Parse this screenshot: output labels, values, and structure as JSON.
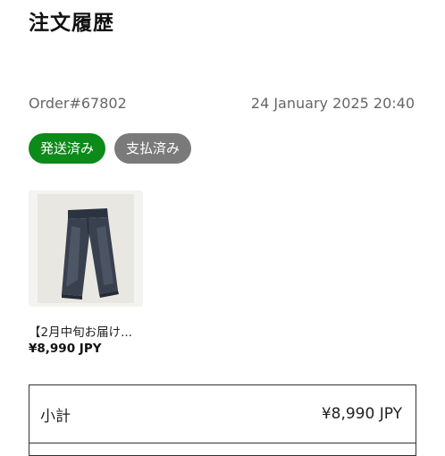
{
  "header": {
    "title": "注文履歴"
  },
  "order": {
    "number": "Order#67802",
    "date": "24 January 2025 20:40",
    "badges": [
      {
        "label": "発送済み",
        "color": "#0c8a1a"
      },
      {
        "label": "支払済み",
        "color": "#7a7a7a"
      }
    ]
  },
  "items": [
    {
      "name": "【2月中旬お届け...",
      "price": "¥8,990 JPY",
      "image_icon": "jeans-photo"
    }
  ],
  "summary": {
    "subtotal_label": "小計",
    "subtotal_value": "¥8,990 JPY"
  }
}
